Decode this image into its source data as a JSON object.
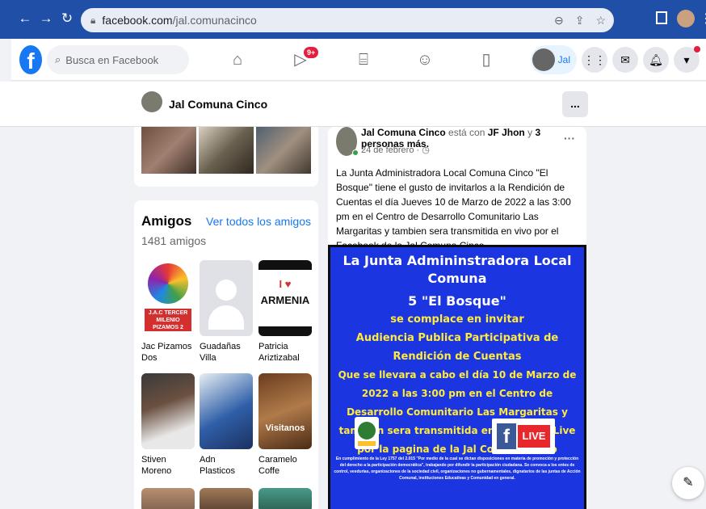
{
  "browser": {
    "url_host": "facebook.com",
    "url_path": "/jal.comunacinco"
  },
  "topbar": {
    "search_placeholder": "Busca en Facebook",
    "video_badge": "9+",
    "profile_label": "Jal"
  },
  "page": {
    "name": "Jal Comuna Cinco",
    "more_label": "..."
  },
  "friends": {
    "title": "Amigos",
    "count": "1481 amigos",
    "see_all": "Ver todos los amigos",
    "items": [
      {
        "name": "Jac Pizamos Dos"
      },
      {
        "name": "Guadañas Villa"
      },
      {
        "name": "Patricia Ariztizabal"
      },
      {
        "name": "Stiven Moreno"
      },
      {
        "name": "Adn Plasticos"
      },
      {
        "name": "Caramelo Coffe"
      }
    ],
    "pic_texts": {
      "jac": "J.A.C TERCER MILENIO PIZAMOS 2",
      "armenia_heart": "I ♥",
      "armenia": "ARMENIA",
      "caramelo": "Visitanos"
    }
  },
  "post": {
    "author": "Jal Comuna Cinco",
    "with_text": "está con",
    "tag1": "JF Jhon",
    "and_text": "y",
    "tag2": "3 personas más.",
    "date": "24 de febrero · ◷",
    "body": "La Junta Administradora Local Comuna Cinco \"El Bosque\" tiene el gusto de invitarlos a la Rendición de Cuentas el día Jueves 10 de Marzo de 2022 a las 3:00 pm en el Centro de Desarrollo Comunitario Las Margaritas y tambien sera transmitida en vivo por el Facebook de la Jal Comuna Cinco.",
    "flyer": {
      "line1": "La Junta Admininstradora Local Comuna",
      "line2": "5 \"El Bosque\"",
      "line3": "se complace en invitar",
      "line4": "Audiencia Publica Participativa de Rendición de Cuentas",
      "line5": "Que se llevara a cabo el día 10 de Marzo de 2022  a las 3:00 pm en el Centro de Desarrollo Comunitario Las Margaritas y tambien sera transmitida en Facebook Live por la pagina de la Jal Comuna Cinco",
      "live_f": "f",
      "live_label": "LIVE",
      "fine_print": "En cumplimiento de la Ley 1757 del 2.015 \"Por medio de la cual se dictan disposiciones en materia de promoción y protección del derecho a la participación democrática\", trabajando por difundir la participación ciudadana. Se convoca a los entes de control, veedurías, organizaciones de la sociedad civil, organizaciones no gubernamentales, dignatarios de las juntas de Acción Comunal, instituciones Educativas y Comunidad en general."
    }
  },
  "colors": {
    "chrome_blue": "#1f4fa6",
    "fb_blue": "#1877f2",
    "flyer_blue": "#1b35e0",
    "badge_red": "#e41e3f"
  }
}
